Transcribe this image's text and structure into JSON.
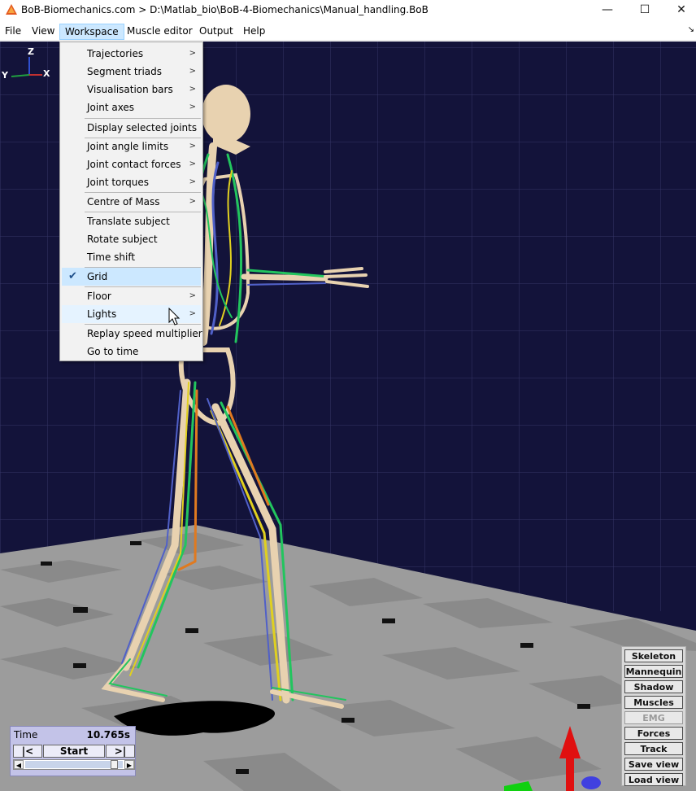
{
  "window": {
    "title": "BoB-Biomechanics.com  > D:\\Matlab_bio\\BoB-4-Biomechanics\\Manual_handling.BoB",
    "minimize_glyph": "—",
    "maximize_glyph": "☐",
    "close_glyph": "✕"
  },
  "menubar": {
    "items": [
      "File",
      "View",
      "Workspace",
      "Muscle editor",
      "Output",
      "Help"
    ],
    "active": "Workspace"
  },
  "axes_triad": {
    "z": "Z",
    "y": "Y",
    "x": "X"
  },
  "workspace_menu": {
    "items": [
      {
        "label": "Trajectories",
        "submenu": true
      },
      {
        "label": "Segment triads",
        "submenu": true
      },
      {
        "label": "Visualisation bars",
        "submenu": true
      },
      {
        "label": "Joint axes",
        "submenu": true
      },
      {
        "label": "Display selected joints",
        "submenu": false
      },
      {
        "label": "Joint angle limits",
        "submenu": true
      },
      {
        "label": "Joint contact forces",
        "submenu": true
      },
      {
        "label": "Joint torques",
        "submenu": true
      },
      {
        "label": "Centre of Mass",
        "submenu": true
      },
      {
        "label": "Translate subject",
        "submenu": false
      },
      {
        "label": "Rotate subject",
        "submenu": false
      },
      {
        "label": "Time shift",
        "submenu": false
      },
      {
        "label": "Grid",
        "submenu": false,
        "checked": true
      },
      {
        "label": "Floor",
        "submenu": true
      },
      {
        "label": "Lights",
        "submenu": true
      },
      {
        "label": "Replay speed multiplier",
        "submenu": false
      },
      {
        "label": "Go to time",
        "submenu": false
      }
    ],
    "submenu_glyph": ">",
    "check_glyph": "✔"
  },
  "time_panel": {
    "label": "Time",
    "value": "10.765s",
    "prev_label": "|<",
    "start_label": "Start",
    "next_label": ">|",
    "slider_position": 0.95
  },
  "view_buttons": [
    {
      "label": "Skeleton",
      "enabled": true
    },
    {
      "label": "Mannequin",
      "enabled": true
    },
    {
      "label": "Shadow",
      "enabled": true
    },
    {
      "label": "Muscles",
      "enabled": true
    },
    {
      "label": "EMG",
      "enabled": false
    },
    {
      "label": "Forces",
      "enabled": true
    },
    {
      "label": "Track",
      "enabled": true
    },
    {
      "label": "Save view",
      "enabled": true
    },
    {
      "label": "Load view",
      "enabled": true
    }
  ],
  "colors": {
    "background": "#13133a",
    "grid": "#3a3a68",
    "floor_light": "#a5a5a5",
    "floor_dark": "#8a8a8a",
    "bone": "#e8d2b0",
    "muscle_green": "#22c55e",
    "muscle_yellow": "#e0d020",
    "muscle_blue": "#5060c8",
    "highlight_yellow": "#f5ef40"
  }
}
